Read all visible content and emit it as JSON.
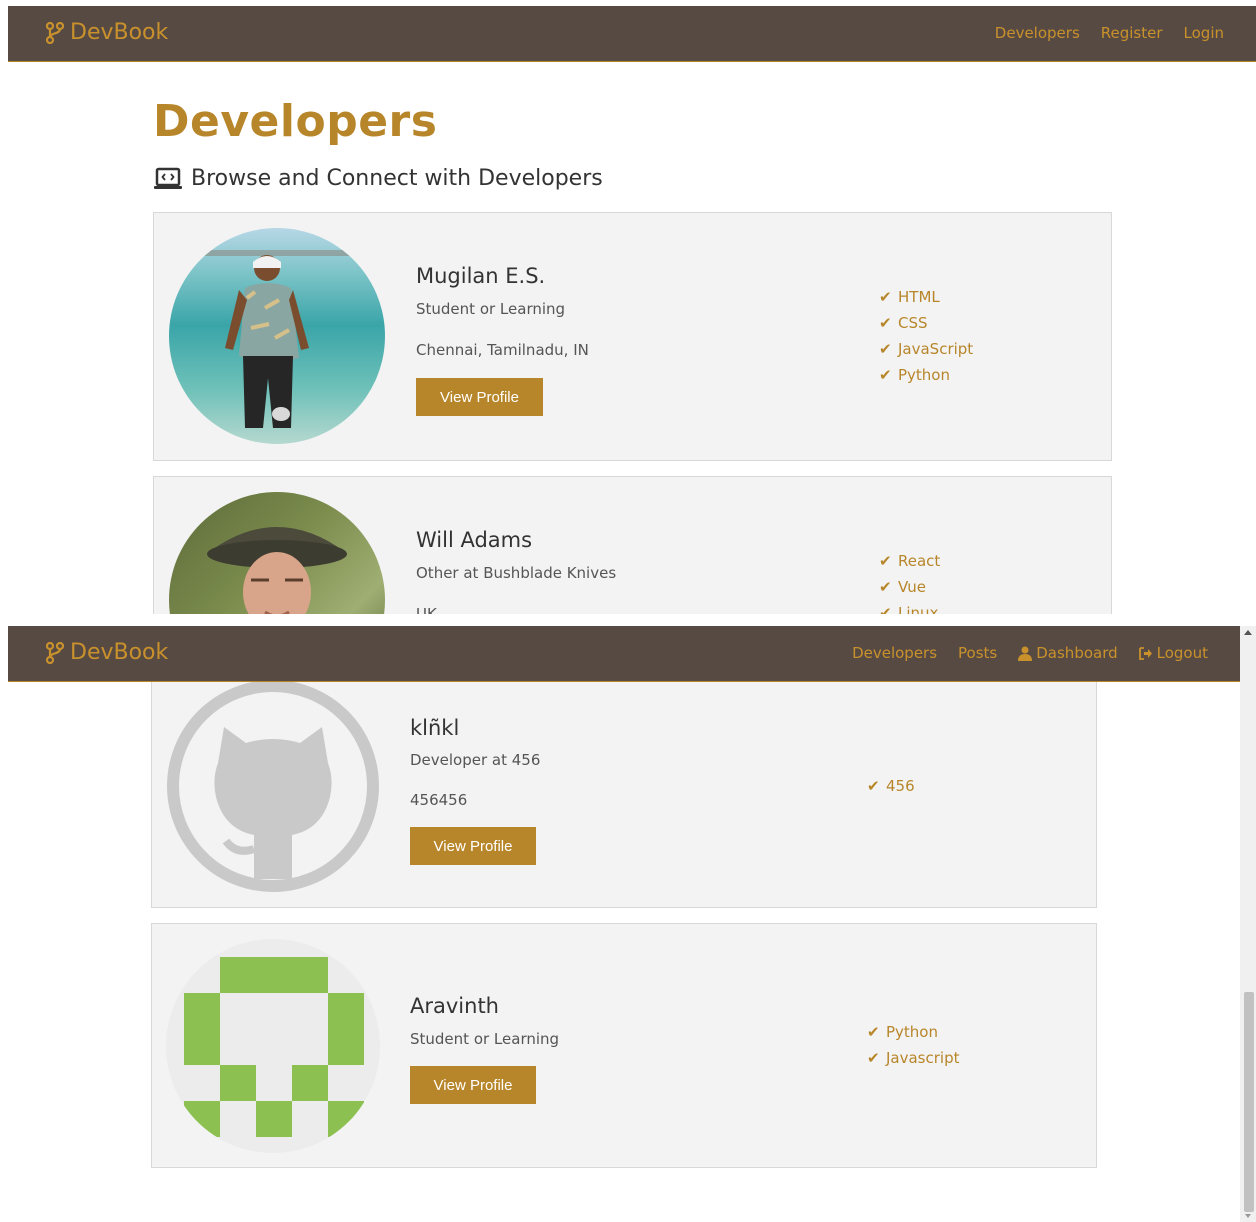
{
  "top": {
    "brand": "DevBook",
    "nav": [
      "Developers",
      "Register",
      "Login"
    ],
    "title": "Developers",
    "lead": "Browse and Connect with Developers",
    "profiles": [
      {
        "name": "Mugilan E.S.",
        "status": "Student or Learning",
        "location": "Chennai, Tamilnadu, IN",
        "button": "View Profile",
        "skills": [
          "HTML",
          "CSS",
          "JavaScript",
          "Python"
        ]
      },
      {
        "name": "Will Adams",
        "status": "Other at Bushblade Knives",
        "location": "UK",
        "skills": [
          "React",
          "Vue",
          "Linux"
        ]
      }
    ]
  },
  "bottom": {
    "brand": "DevBook",
    "nav": [
      "Developers",
      "Posts",
      "Dashboard",
      "Logout"
    ],
    "profiles": [
      {
        "name": "klñkl",
        "status": "Developer at 456",
        "location": "456456",
        "button": "View Profile",
        "skills": [
          "456"
        ]
      },
      {
        "name": "Aravinth",
        "status": "Student or Learning",
        "button": "View Profile",
        "skills": [
          "Python",
          "Javascript"
        ]
      }
    ]
  },
  "colors": {
    "navbar": "#574a43",
    "accent": "#b8862a",
    "card": "#f3f3f3"
  }
}
